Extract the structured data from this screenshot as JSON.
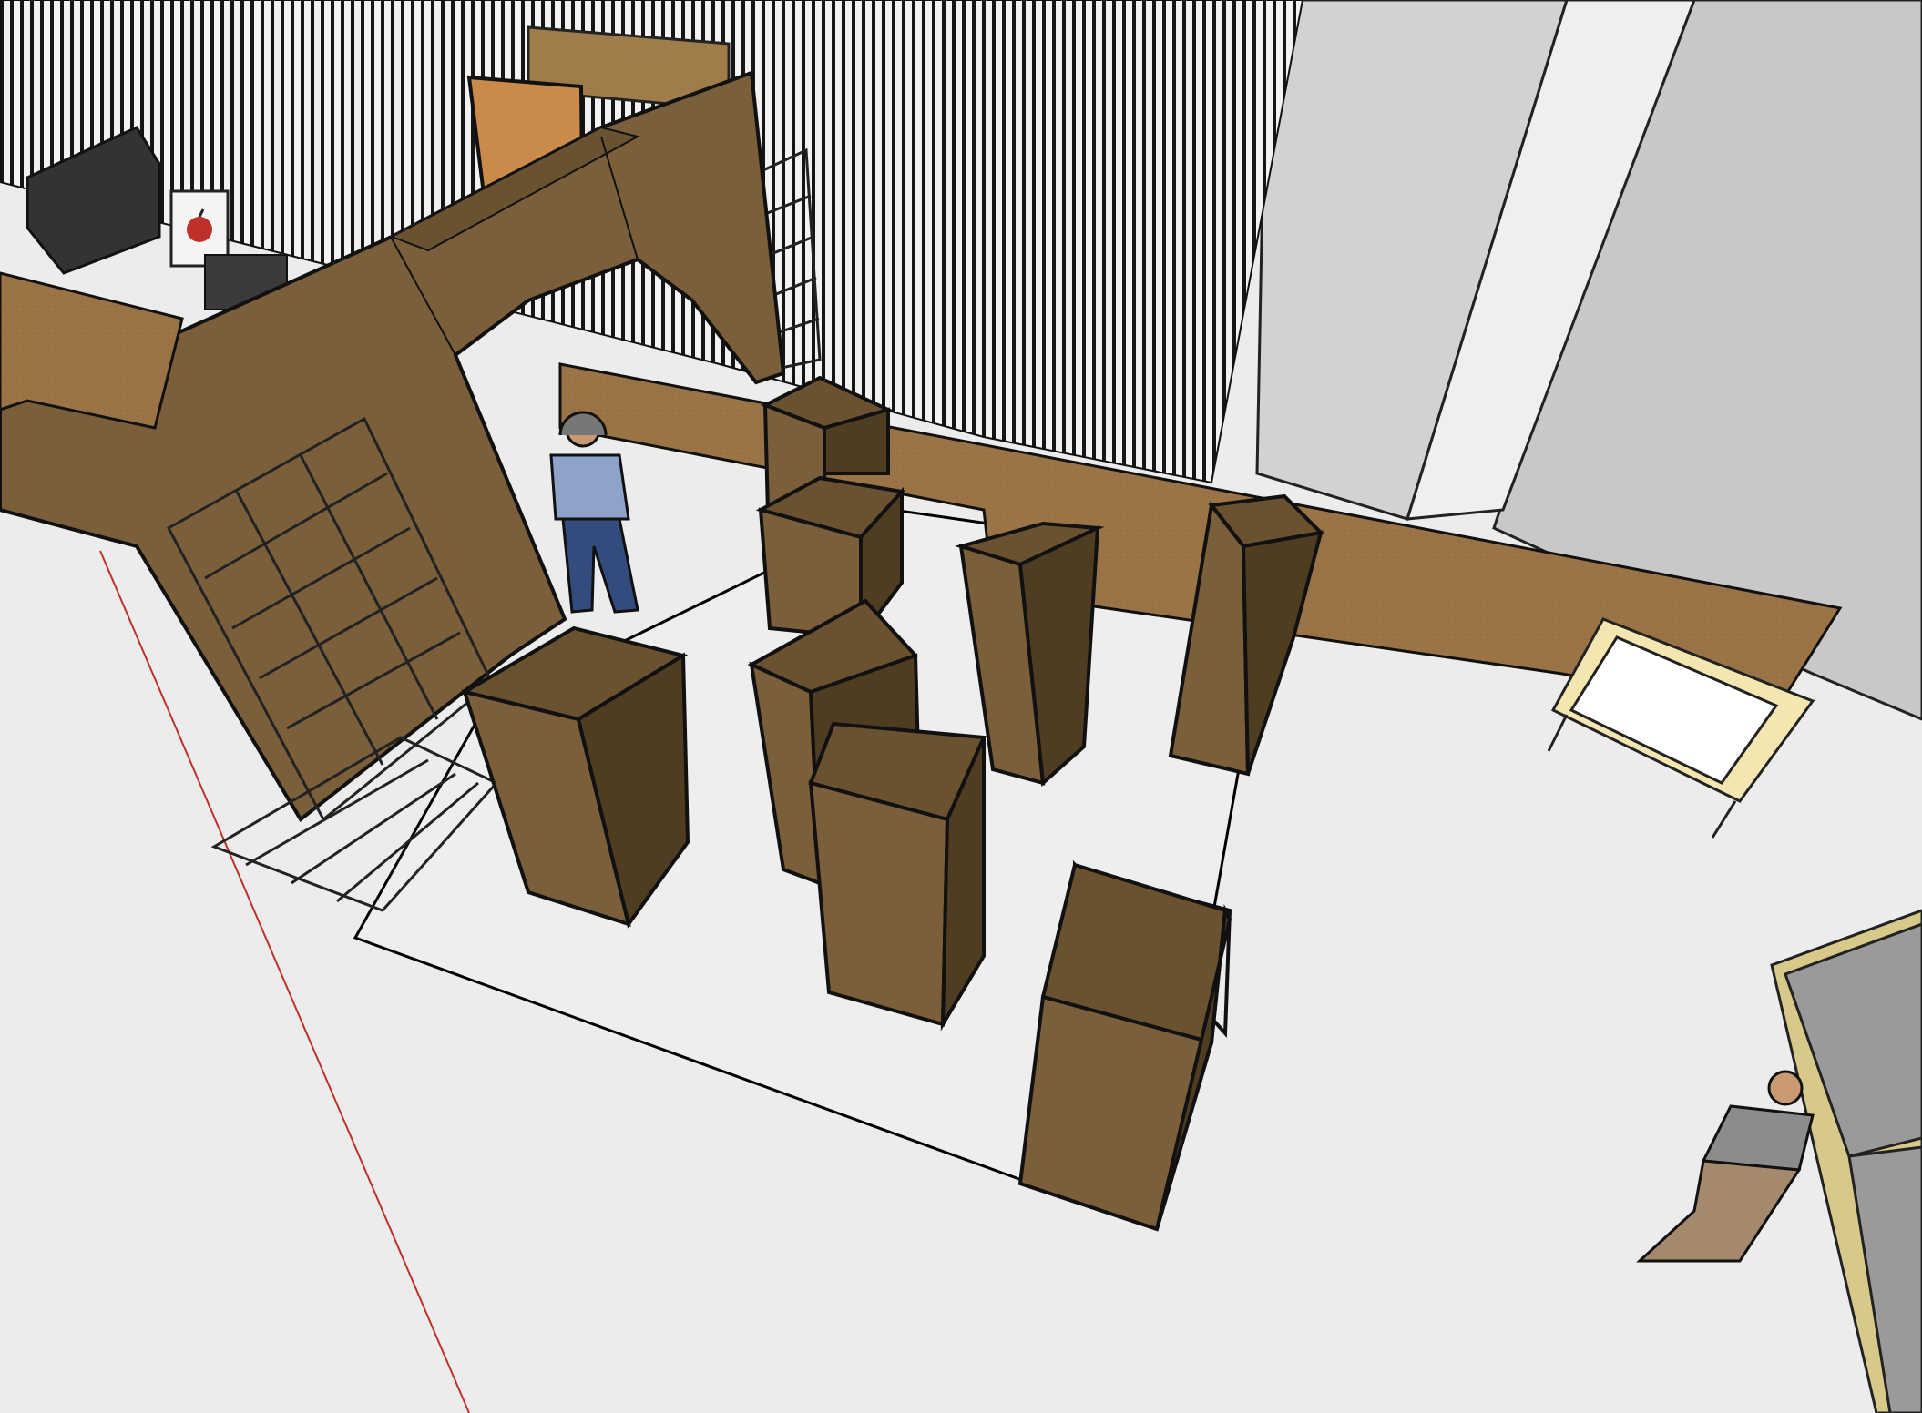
{
  "scene": {
    "kind": "3d-model-viewport",
    "colors": {
      "background": "#ececec",
      "floor_inner": "#ededed",
      "cardboard_front": "#7a5f3a",
      "cardboard_side": "#4f3d22",
      "cardboard_top": "#6a5230",
      "cardboard_light": "#9a7447",
      "curtain_stripe": "#1a1a1a",
      "wall_grey": "#c9c9c9",
      "metal_frame": "#b8b8b8",
      "axis_red": "#c0302a",
      "orange_panel": "#c98a4a"
    },
    "icons": [
      "apple-icon"
    ]
  }
}
